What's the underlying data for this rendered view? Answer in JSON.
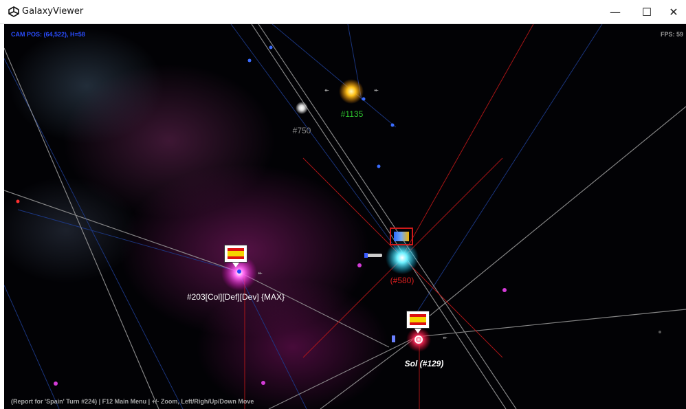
{
  "window": {
    "title": "GalaxyViewer",
    "minimize": "—",
    "maximize": "☐",
    "close": "✕"
  },
  "hud": {
    "cam_pos": "CAM POS: (64,522), H=58",
    "fps": "FPS: 59",
    "status": "(Report for 'Spain' Turn #224) | F12 Main Menu | +/- Zoom, Left/Righ/Up/Down Move"
  },
  "stars": [
    {
      "label": "#1135",
      "color": "#2ec32e"
    },
    {
      "label": "#750",
      "color": "#8a8a8a"
    },
    {
      "label": "#203[Col][Def][Dev] {MAX}",
      "color": "#ffffff"
    },
    {
      "label": "(#580)",
      "color": "#e02020"
    },
    {
      "label": "Sol (#129)",
      "color": "#ffffff"
    }
  ],
  "icons": {
    "app": "unity-logo-icon"
  }
}
